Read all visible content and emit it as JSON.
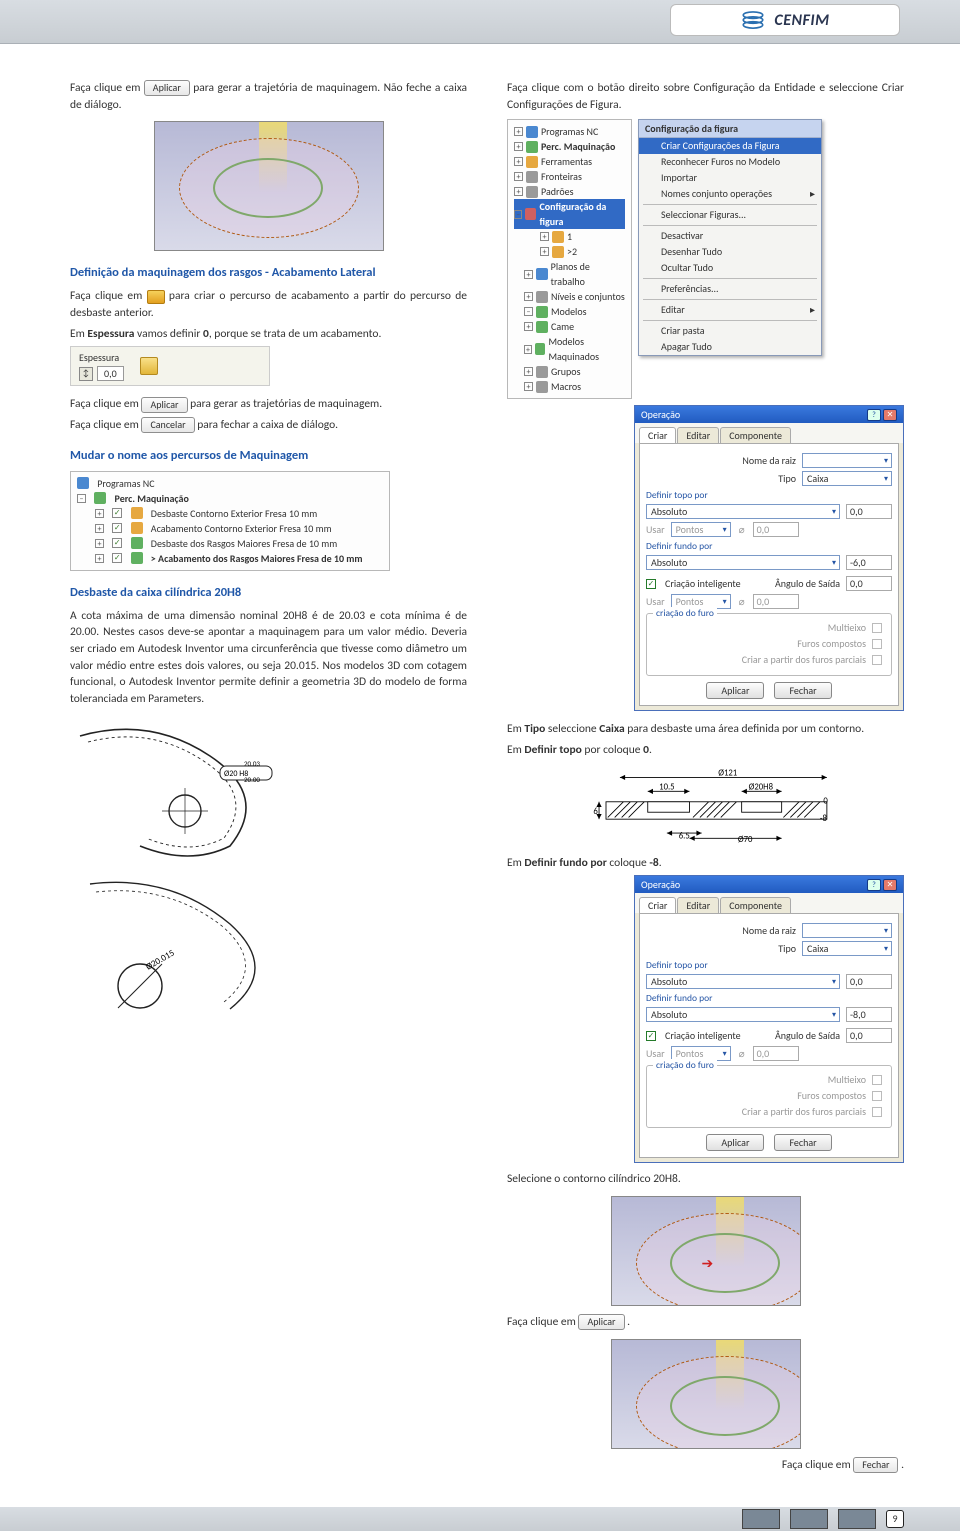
{
  "brand": "CENFIM",
  "col_left": {
    "p1a": "Faça clique em",
    "btn_aplicar": "Aplicar",
    "p1b": "para gerar a trajetória de maquinagem. Não feche a caixa de diálogo.",
    "h1": "Definição da maquinagem dos rasgos - Acabamento Lateral",
    "p2a": "Faça clique em",
    "p2b": "para criar o percurso de acabamento a partir do percurso de desbaste anterior.",
    "p3a": "Em ",
    "p3_bold": "Espessura",
    "p3b": " vamos definir ",
    "p3_bold2": "0",
    "p3c": ", porque se trata de um acabamento.",
    "spinner_label": "Espessura",
    "spinner_value": "0,0",
    "p4a": "Faça clique em",
    "p4b": "para gerar as trajetórias de maquinagem.",
    "p5a": "Faça clique em",
    "btn_cancelar": "Cancelar",
    "p5b": "para fechar a caixa de diálogo.",
    "h2": "Mudar o nome aos percursos de Maquinagem",
    "tree2": {
      "root": "Programas NC",
      "perc": "Perc. Maquinação",
      "items": [
        "Desbaste Contorno Exterior Fresa 10 mm",
        "Acabamento Contorno Exterior Fresa 10 mm",
        "Desbaste dos Rasgos Maiores Fresa de 10 mm",
        "> Acabamento dos Rasgos Maiores Fresa de 10 mm"
      ]
    },
    "h3": "Desbaste da caixa cilíndrica 20H8",
    "p6": "A cota máxima de uma dimensão nominal 20H8 é de 20.03 e cota mínima é de 20.00. Nestes casos deve-se apontar a maquinagem para um valor médio. Deveria ser criado em Autodesk Inventor uma circunferência que tivesse como diâmetro um valor médio entre estes dois valores, ou seja 20.015. Nos modelos 3D com cotagem funcional, o Autodesk Inventor permite definir a geometria 3D do modelo de forma toleranciada em Parameters.",
    "dim_text1": "Ø20 H8",
    "dim_text2": "20.03",
    "dim_text3": "20.00",
    "dim_text4": "Ø20.015"
  },
  "col_right": {
    "p1": "Faça clique com o botão direito sobre Configuração da Entidade e seleccione Criar Configurações de Figura.",
    "tree1": {
      "items": [
        {
          "t": "Programas NC"
        },
        {
          "t": "Perc. Maquinação",
          "bold": true
        },
        {
          "t": "Ferramentas"
        },
        {
          "t": "Fronteiras"
        },
        {
          "t": "Padrões"
        },
        {
          "t": "Configuração da figura",
          "hl": true
        },
        {
          "t": "1"
        },
        {
          "t": ">2"
        },
        {
          "t": "Planos de trabalho"
        },
        {
          "t": "Níveis e conjuntos"
        },
        {
          "t": "Modelos"
        },
        {
          "t": "Came"
        },
        {
          "t": "Modelos Maquinados"
        },
        {
          "t": "Grupos"
        },
        {
          "t": "Macros"
        }
      ]
    },
    "ctx": {
      "title": "Configuração da figura",
      "items": [
        {
          "t": "Criar Configurações da Figura",
          "sel": true
        },
        {
          "t": "Reconhecer Furos no Modelo"
        },
        {
          "t": "Importar"
        },
        {
          "t": "Nomes conjunto operações",
          "arrow": true
        },
        {
          "sep": true
        },
        {
          "t": "Seleccionar Figuras..."
        },
        {
          "sep": true
        },
        {
          "t": "Desactivar"
        },
        {
          "t": "Desenhar Tudo"
        },
        {
          "t": "Ocultar Tudo"
        },
        {
          "sep": true
        },
        {
          "t": "Preferências..."
        },
        {
          "sep": true
        },
        {
          "t": "Editar",
          "arrow": true
        },
        {
          "sep": true
        },
        {
          "t": "Criar pasta"
        },
        {
          "t": "Apagar Tudo"
        }
      ]
    },
    "dlg1": {
      "title": "Operação",
      "tabs": [
        "Criar",
        "Editar",
        "Componente"
      ],
      "nome": "Nome da raiz",
      "tipo_lbl": "Tipo",
      "tipo_val": "Caixa",
      "topo_lbl": "Definir topo por",
      "topo_sel": "Absoluto",
      "topo_val": "0,0",
      "usar": "Usar",
      "pontos": "Pontos",
      "usar_val": "0,0",
      "fundo_lbl": "Definir fundo por",
      "fundo_sel": "Absoluto",
      "fundo_val": "-6,0",
      "cri_int": "Criação inteligente",
      "ang_lbl": "Ângulo de Saída",
      "ang_val": "0,0",
      "grp": "criação do furo",
      "mult": "Multieixo",
      "fc": "Furos compostos",
      "fp": "Criar a partir dos furos parciais",
      "b1": "Aplicar",
      "b2": "Fechar"
    },
    "p2a": "Em ",
    "p2_b1": "Tipo",
    "p2b": " seleccione ",
    "p2_b2": "Caixa",
    "p2c": " para desbaste uma área definida por um contorno.",
    "p3a": "Em ",
    "p3_b1": "Definir topo",
    "p3b": " por coloque ",
    "p3_b2": "0",
    "p3c": ".",
    "dims": {
      "d121": "Ø121",
      "d10_5": "10.5",
      "d20h8": "Ø20H8",
      "d6": "6",
      "d6_5": "6.5",
      "d70": "Ø70",
      "z0": "0",
      "zm8": "-8"
    },
    "p4a": "Em ",
    "p4_b1": "Definir fundo por",
    "p4b": " coloque ",
    "p4_b2": "-8",
    "p4c": ".",
    "dlg2_fundo": "-8,0",
    "p5": "Selecione o contorno cilíndrico 20H8.",
    "p6a": "Faça clique em",
    "p7a": "Faça clique em",
    "btn_fechar": "Fechar"
  },
  "page_number": "9"
}
